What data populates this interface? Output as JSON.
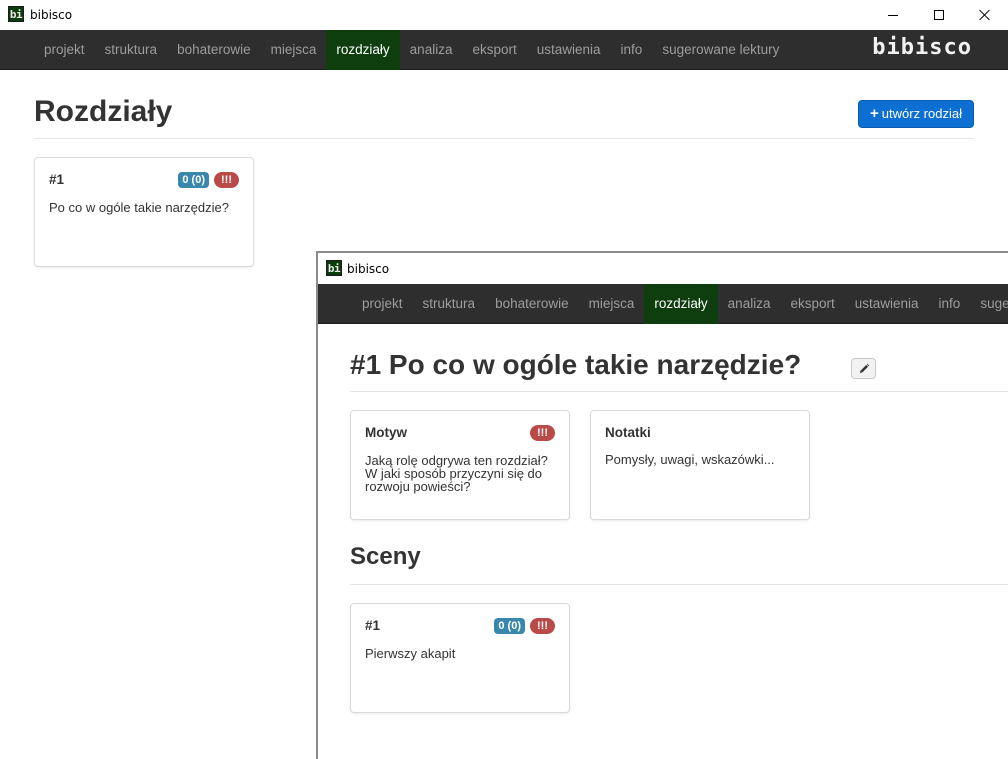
{
  "window": {
    "title": "bibisco",
    "logo_text": "bi"
  },
  "nav": {
    "items": [
      "projekt",
      "struktura",
      "bohaterowie",
      "miejsca",
      "rozdziały",
      "analiza",
      "eksport",
      "ustawienia",
      "info",
      "sugerowane lektury"
    ],
    "active": "rozdziały",
    "brand": "bibisco"
  },
  "main": {
    "title": "Rozdziały",
    "create_button": "utwórz rodział",
    "chapters": [
      {
        "number": "#1",
        "title": "Po co w ogóle takie narzędzie?",
        "badge_count": "0 (0)",
        "badge_alert": "!!!"
      }
    ]
  },
  "detail_window": {
    "title": "bibisco",
    "chapter_title": "#1 Po co w ogóle takie narzędzie?",
    "motive_card": {
      "title": "Motyw",
      "badge": "!!!",
      "text": "Jaką rolę odgrywa ten rozdział? W jaki sposób przyczyni się do rozwoju powieści?"
    },
    "notes_card": {
      "title": "Notatki",
      "text": "Pomysły, uwagi, wskazówki..."
    },
    "scenes_title": "Sceny",
    "scenes": [
      {
        "number": "#1",
        "title": "Pierwszy akapit",
        "badge_count": "0 (0)",
        "badge_alert": "!!!"
      }
    ]
  }
}
